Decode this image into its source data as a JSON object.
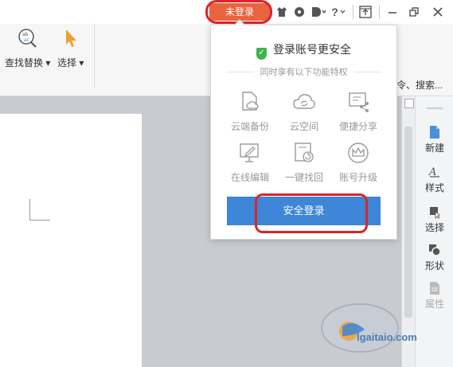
{
  "titlebar": {
    "login_button": "未登录",
    "icons": [
      "shirt-icon",
      "settings-dot-icon",
      "theme-icon",
      "help-icon",
      "share-window-icon",
      "minimize-icon",
      "restore-icon",
      "close-icon"
    ],
    "help_label": "?"
  },
  "ribbon": {
    "find_replace": "查找替换",
    "select": "选择",
    "right_overflow": "令、搜索..."
  },
  "popup": {
    "title": "登录账号更安全",
    "subtitle": "同时享有以下功能特权",
    "features": [
      {
        "label": "云端备份",
        "icon": "cloud-backup-icon"
      },
      {
        "label": "云空间",
        "icon": "cloud-space-icon"
      },
      {
        "label": "便捷分享",
        "icon": "share-icon"
      },
      {
        "label": "在线编辑",
        "icon": "online-edit-icon"
      },
      {
        "label": "一键找回",
        "icon": "recover-icon"
      },
      {
        "label": "账号升级",
        "icon": "crown-icon"
      }
    ],
    "login_button": "安全登录"
  },
  "sidepanel": {
    "items": [
      "新建",
      "样式",
      "选择",
      "形状",
      "属性"
    ]
  },
  "watermark": {
    "text": "lgaitaio.com"
  },
  "colors": {
    "login_orange": "#e8643f",
    "annotation_red": "#d8262b",
    "primary_blue": "#3d86d8",
    "shield_green": "#3cb44b"
  }
}
